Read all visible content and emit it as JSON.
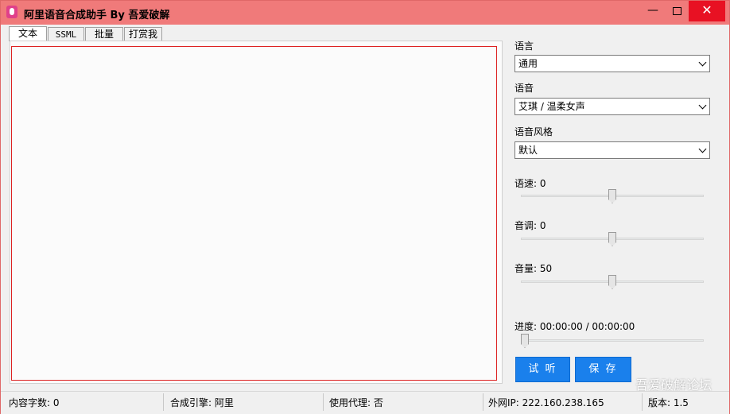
{
  "window": {
    "title": "阿里语音合成助手 By 吾爱破解",
    "min_glyph": "—",
    "close_glyph": "✕"
  },
  "tabs": [
    {
      "label": "文本",
      "active": true
    },
    {
      "label": "SSML",
      "active": false
    },
    {
      "label": "批量",
      "active": false
    },
    {
      "label": "打赏我",
      "active": false
    }
  ],
  "editor": {
    "value": ""
  },
  "settings": {
    "language_label": "语言",
    "language_value": "通用",
    "voice_label": "语音",
    "voice_value": "艾琪 / 温柔女声",
    "style_label": "语音风格",
    "style_value": "默认",
    "speed_label": "语速: ",
    "speed_value": "0",
    "pitch_label": "音调: ",
    "pitch_value": "0",
    "volume_label": "音量: ",
    "volume_value": "50",
    "progress_label": "进度: ",
    "progress_value": "00:00:00 / 00:00:00",
    "speed_level": 0.5,
    "pitch_level": 0.5,
    "volume_level": 0.5,
    "progress_level": 0.0
  },
  "actions": {
    "listen_label": "试 听",
    "save_label": "保 存"
  },
  "status": {
    "char_count_label": "内容字数: ",
    "char_count": "0",
    "engine_label": "合成引擎: ",
    "engine": "阿里",
    "proxy_label": "使用代理: ",
    "proxy": "否",
    "ip_label": "外网IP: ",
    "ip": "222.160.238.165",
    "version_label": "版本: ",
    "version": "1.5"
  },
  "watermark": "吾爱破解论坛",
  "colors": {
    "titlebar": "#f07a7a",
    "accent_button": "#1a80ec",
    "close_button": "#e81123"
  }
}
